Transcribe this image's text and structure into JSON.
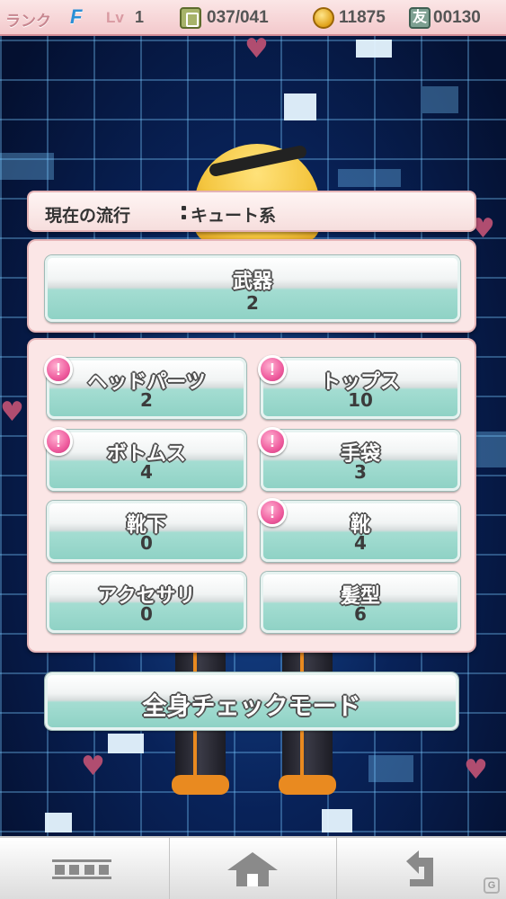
{
  "status_bar": {
    "rank_label": "ランク",
    "rank_value": "F",
    "level_label": "Lv",
    "level_value": "1",
    "closet_count": "037/041",
    "coins": "11875",
    "friend_icon_glyph": "友",
    "friend_points": "00130"
  },
  "trend": {
    "label": "現在の流行",
    "value": "キュート系"
  },
  "weapon": {
    "label": "武器",
    "count": "2"
  },
  "categories": [
    {
      "label": "ヘッドパーツ",
      "count": "2",
      "alert": true
    },
    {
      "label": "トップス",
      "count": "10",
      "alert": true
    },
    {
      "label": "ボトムス",
      "count": "4",
      "alert": true
    },
    {
      "label": "手袋",
      "count": "3",
      "alert": true
    },
    {
      "label": "靴下",
      "count": "0",
      "alert": false
    },
    {
      "label": "靴",
      "count": "4",
      "alert": true
    },
    {
      "label": "アクセサリ",
      "count": "0",
      "alert": false
    },
    {
      "label": "髪型",
      "count": "6",
      "alert": false
    }
  ],
  "alert_glyph": "!",
  "full_body_check_label": "全身チェックモード",
  "bottom_nav": {
    "menu_icon": "menu-icon",
    "home_icon": "home-icon",
    "back_icon": "back-icon"
  },
  "watermark_glyph": "G",
  "colors": {
    "status_bar_bg": "#f3c9cc",
    "panel_bg": "#fbe6e6",
    "button_teal": "#8fd2c5",
    "alert_pink": "#ef5c9e",
    "rank_blue": "#2a8fd6"
  }
}
